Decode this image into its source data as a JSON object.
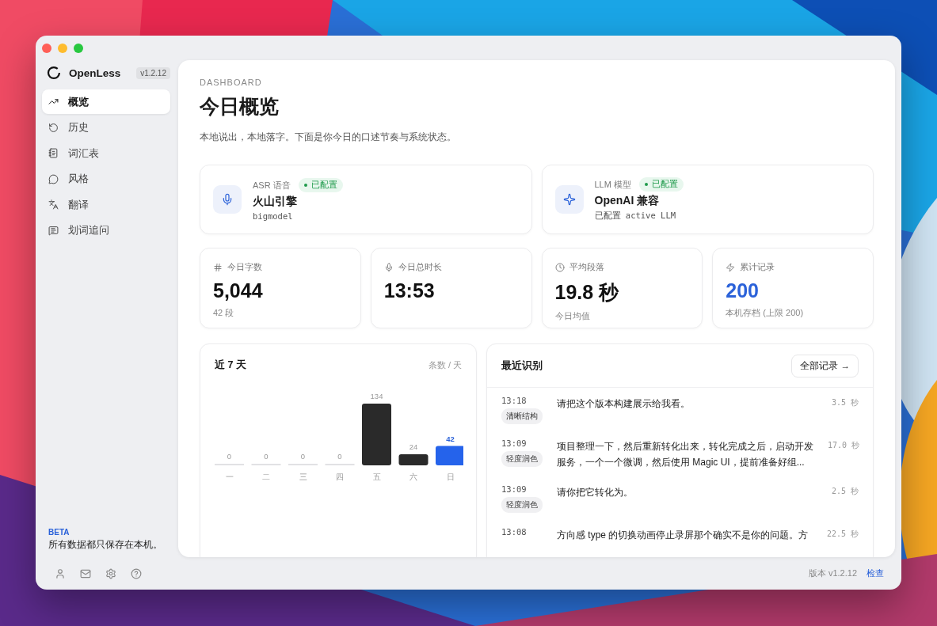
{
  "sidebar": {
    "app_name": "OpenLess",
    "version": "v1.2.12",
    "items": [
      {
        "label": "概览",
        "selected": true
      },
      {
        "label": "历史",
        "selected": false
      },
      {
        "label": "词汇表",
        "selected": false
      },
      {
        "label": "风格",
        "selected": false
      },
      {
        "label": "翻译",
        "selected": false
      },
      {
        "label": "划词追问",
        "selected": false
      }
    ],
    "beta": {
      "badge": "BETA",
      "note": "所有数据都只保存在本机。"
    }
  },
  "footer": {
    "version": "版本 v1.2.12",
    "check": "检查"
  },
  "header": {
    "eyebrow": "DASHBOARD",
    "title": "今日概览",
    "subtitle": "本地说出，本地落字。下面是你今日的口述节奏与系统状态。"
  },
  "services": [
    {
      "label": "ASR 语音",
      "status": "已配置",
      "configured": true,
      "name": "火山引擎",
      "detail": "bigmodel"
    },
    {
      "label": "LLM 模型",
      "status": "已配置",
      "configured": true,
      "name": "OpenAI 兼容",
      "detail": "已配置 active LLM"
    }
  ],
  "stats": [
    {
      "label": "今日字数",
      "value": "5,044",
      "note": "42 段",
      "highlighted": false
    },
    {
      "label": "今日总时长",
      "value": "13:53",
      "highlighted": false
    },
    {
      "label": "平均段落",
      "value": "19.8 秒",
      "note": "今日均值",
      "highlighted": false
    },
    {
      "label": "累计记录",
      "value": "200",
      "note": "本机存档 (上限 200)",
      "highlighted": true
    }
  ],
  "week_chart": {
    "title": "近 7 天",
    "unit": "条数 / 天",
    "bars": [
      {
        "selected": false
      },
      {
        "selected": false
      },
      {
        "selected": false
      },
      {
        "selected": false
      },
      {
        "selected": false
      },
      {
        "selected": false
      },
      {
        "selected": true
      }
    ],
    "chart_data": {
      "type": "bar",
      "categories": [
        "一",
        "二",
        "三",
        "四",
        "五",
        "六",
        "日"
      ],
      "data_labels": true,
      "series": [
        {
          "values": [
            0,
            0,
            0,
            0,
            134,
            24,
            42
          ]
        }
      ]
    }
  },
  "recent": {
    "title": "最近识别",
    "all_button": "全部记录 →",
    "rows": [
      {
        "time": "13:18",
        "tag": "清晰结构",
        "lines": [
          "请把这个版本构建展示给我看。"
        ],
        "duration": "3.5 秒"
      },
      {
        "time": "13:09",
        "tag": "轻度润色",
        "lines": [
          "项目整理一下，然后重新转化出来，转化完成之后，启动开发",
          "服务，一个一个微调，然后使用 Magic UI，提前准备好组..."
        ],
        "duration": "17.0 秒"
      },
      {
        "time": "13:09",
        "tag": "轻度润色",
        "lines": [
          "请你把它转化为。"
        ],
        "duration": "2.5 秒"
      },
      {
        "time": "13:08",
        "lines": [
          "方向感 type 的切换动画停止录屏那个确实不是你的问题。方"
        ],
        "duration": "22.5 秒"
      }
    ]
  }
}
